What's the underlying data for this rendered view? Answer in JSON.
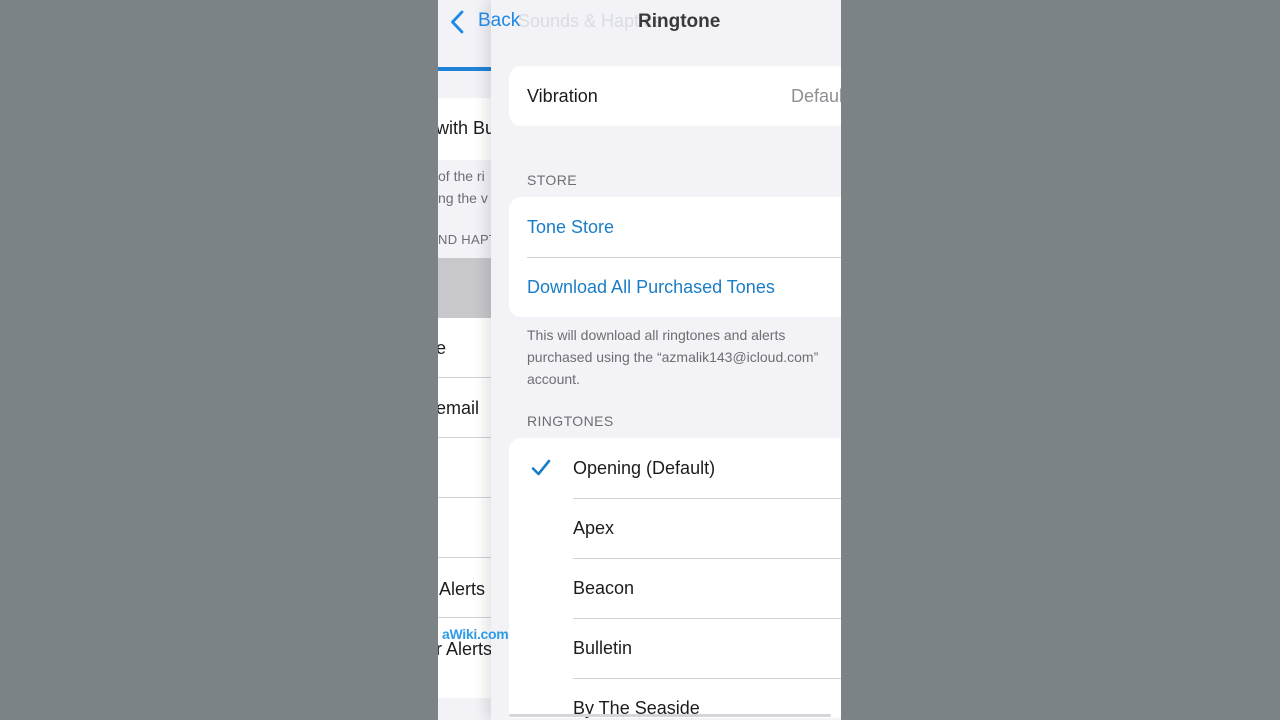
{
  "nav": {
    "back_label": "Back",
    "previous_title": "Sounds & Haptics",
    "title": "Ringtone"
  },
  "underlying_page": {
    "row_1": "with Bu",
    "footer_line_1": "of the ri",
    "footer_line_2": "ng the v",
    "section_header": "ND HAPT",
    "row_2": "e",
    "row_3": "email",
    "row_4": "Alerts",
    "row_5": "r Alerts"
  },
  "vibration": {
    "label": "Vibration",
    "value": "Default"
  },
  "store": {
    "header": "STORE",
    "tone_store": "Tone Store",
    "download_all": "Download All Purchased Tones",
    "footnote": "This will download all ringtones and alerts purchased using the “azmalik143@icloud.com” account."
  },
  "ringtones": {
    "header": "RINGTONES",
    "items": [
      {
        "name": "Opening (Default)",
        "selected": true
      },
      {
        "name": "Apex",
        "selected": false
      },
      {
        "name": "Beacon",
        "selected": false
      },
      {
        "name": "Bulletin",
        "selected": false
      },
      {
        "name": "By The Seaside",
        "selected": false
      }
    ]
  },
  "watermark": "aWiki.com",
  "colors": {
    "accent": "#1a7dc7",
    "background": "#f2f2f7",
    "cell": "#ffffff"
  }
}
